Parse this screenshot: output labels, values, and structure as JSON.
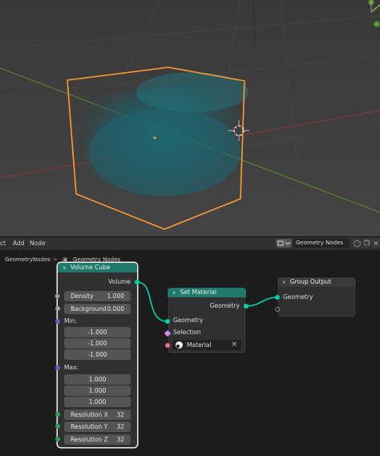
{
  "header": {
    "menu": [
      "ct",
      "Add",
      "Node"
    ],
    "tree_name": "Geometry Nodes"
  },
  "breadcrumb": {
    "object": "GeometryNodes",
    "modifier": "Geometry Nodes"
  },
  "nodes": {
    "volume_cube": {
      "title": "Volume Cube",
      "output": "Volume",
      "density_label": "Density",
      "density_value": "1.000",
      "background_label": "Background",
      "background_value": "0.000",
      "min_label": "Min:",
      "min_values": [
        "-1.000",
        "-1.000",
        "-1.000"
      ],
      "max_label": "Max:",
      "max_values": [
        "1.000",
        "1.000",
        "1.000"
      ],
      "res_x_label": "Resolution X",
      "res_x_value": "32",
      "res_y_label": "Resolution Y",
      "res_y_value": "32",
      "res_z_label": "Resolution Z",
      "res_z_value": "32"
    },
    "set_material": {
      "title": "Set Material",
      "output": "Geometry",
      "input_geometry": "Geometry",
      "input_selection": "Selection",
      "material_value": "Material"
    },
    "group_output": {
      "title": "Group Output",
      "input_geometry": "Geometry"
    }
  },
  "colors": {
    "geometry_socket": "#00d6a3",
    "selection_outline": "#ff9a2e",
    "geometry_node_header": "#1f7a6b"
  }
}
